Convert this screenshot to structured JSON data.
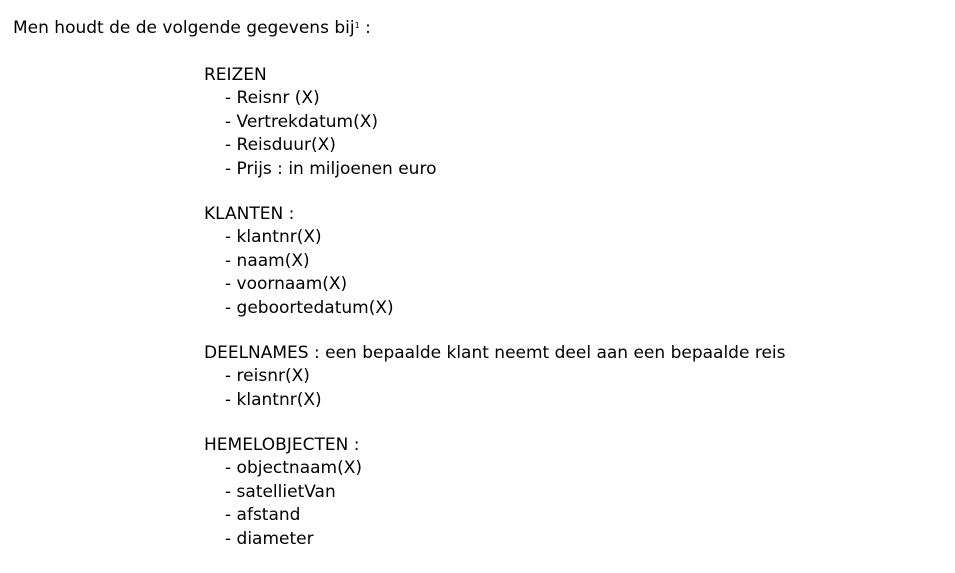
{
  "intro": {
    "text": "Men houdt de de volgende gegevens bij",
    "footnote_mark": "1",
    "suffix": " :"
  },
  "sections": [
    {
      "title": "REIZEN",
      "fields": [
        "- Reisnr (X)",
        "- Vertrekdatum(X)",
        "- Reisduur(X)",
        "- Prijs : in miljoenen euro"
      ]
    },
    {
      "title": "KLANTEN :",
      "fields": [
        "- klantnr(X)",
        "- naam(X)",
        "- voornaam(X)",
        "- geboortedatum(X)"
      ]
    },
    {
      "title": "DEELNAMES : een bepaalde klant neemt deel aan een bepaalde reis",
      "fields": [
        "- reisnr(X)",
        "- klantnr(X)"
      ]
    },
    {
      "title": "HEMELOBJECTEN :",
      "fields": [
        "- objectnaam(X)",
        "- satellietVan",
        "- afstand",
        "- diameter"
      ]
    }
  ]
}
